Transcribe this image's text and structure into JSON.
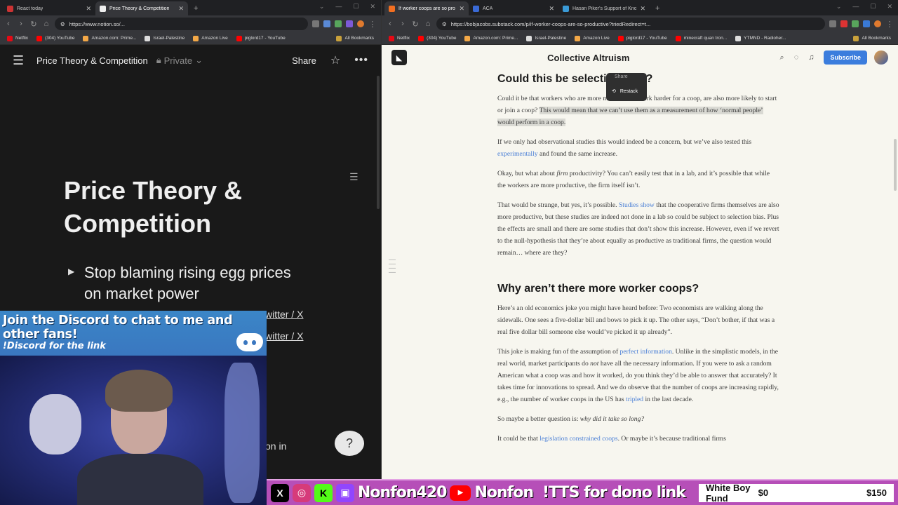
{
  "left_browser": {
    "tabs": [
      {
        "label": "React today",
        "color": "#cc3333"
      },
      {
        "label": "Price Theory & Competition",
        "color": "#eeeeee"
      }
    ],
    "url": "https://www.notion.so/...",
    "bookmarks": [
      "Netflix",
      "(304) YouTube",
      "Amazon.com: Prime...",
      "Israel-Palestine",
      "Amazon Live",
      "piglord17 - YouTube"
    ],
    "all_bookmarks": "All Bookmarks"
  },
  "right_browser": {
    "tabs": [
      {
        "label": "If worker coops are so productiv...",
        "color": "#f26f21"
      },
      {
        "label": "ACA",
        "color": "#3a6ad6"
      },
      {
        "label": "Hasan Piker's Support of Know...",
        "color": "#3a9ad6"
      }
    ],
    "url": "https://bobjacobs.substack.com/p/if-worker-coops-are-so-productive?triedRedirect=t...",
    "bookmarks": [
      "Netflix",
      "(304) YouTube",
      "Amazon.com: Prime...",
      "Israel-Palestine",
      "Amazon Live",
      "piglord17 - YouTube",
      "minecraft quan tron...",
      "YTMND - Radioher..."
    ],
    "all_bookmarks": "All Bookmarks"
  },
  "notion": {
    "page_title": "Price Theory & Competition",
    "private": "Private",
    "share": "Share",
    "heading": "Price Theory & Competition",
    "toggle_text": "Stop blaming rising egg prices on market power",
    "twitter1": "witter / X",
    "twitter2": "witter / X",
    "on_in": "on in"
  },
  "overlay": {
    "discord_line1": "Join the Discord to chat to me and other fans!",
    "discord_line2": "!Discord for the link",
    "handle1": "Nonfon420",
    "handle2": "Nonfon",
    "tts": "!TTS for dono link",
    "goal_name": "White Boy Fund",
    "goal_current": "$0",
    "goal_target": "$150"
  },
  "substack": {
    "publication": "Collective Altruism",
    "subscribe": "Subscribe",
    "popover_top": "Share",
    "popover_restack": "Restack",
    "h_select": "Could this be selection bias?",
    "p1_a": "Could it be that workers who are more motivated to work harder for a coop, are also more likely to start or join a coop?",
    "p1_b": "This would mean that we can’t use them as a measurement of how ‘normal people’ would perform in a coop.",
    "p2_a": "If we only had observational studies this would indeed be a concern, but we’ve also tested this",
    "p2_link": "experimentally",
    "p2_b": "and found the same increase.",
    "p3_a": "Okay, but what about",
    "p3_em": "firm",
    "p3_b": "productivity? You can’t easily test that in a lab, and it’s possible that while the workers are more productive, the firm itself isn’t.",
    "p4_a": "That would be strange, but yes, it’s possible.",
    "p4_link": "Studies show",
    "p4_b": "that the cooperative firms themselves are also more productive, but these studies are indeed not done in a lab so could be subject to selection bias. Plus the effects are small and there are some studies that don’t show this increase. However, even if we revert to the null-hypothesis that they’re about equally as productive as traditional firms, the question would remain… where are they?",
    "h_why": "Why aren’t there more worker coops?",
    "p5": "Here’s an old economics joke you might have heard before: Two economists are walking along the sidewalk. One sees a five-dollar bill and bows to pick it up. The other says, “Don’t bother, if that was a real five dollar bill someone else would’ve picked it up already”.",
    "p6_a": "This joke is making fun of the assumption of",
    "p6_link": "perfect information",
    "p6_b": ". Unlike in the simplistic models, in the real world, market participants do",
    "p6_em": "not",
    "p6_c": "have all the necessary information. If you were to ask a random American what a coop was and how it worked, do you think they’d be able to answer that accurately? It takes time for innovations to spread. And we do observe that the number of coops are increasing rapidly, e.g., the number of worker coops in the US has",
    "p6_link2": "tripled",
    "p6_d": "in the last decade.",
    "p7_a": "So maybe a better question is:",
    "p7_em": "why did it take so long?",
    "p8_a": "It could be that",
    "p8_link": "legislation constrained coops",
    "p8_b": ". Or maybe it’s because traditional firms"
  }
}
